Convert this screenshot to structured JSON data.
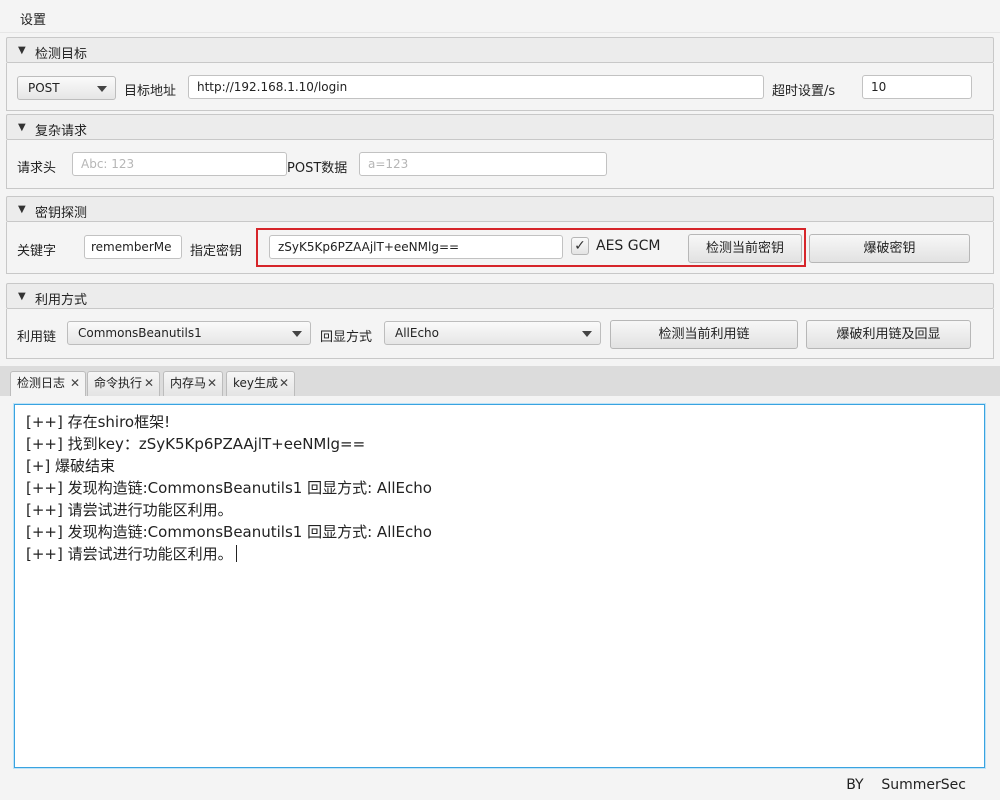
{
  "menubar": {
    "settings": "设置"
  },
  "target_section": {
    "title": "检测目标",
    "method": "POST",
    "url_label": "目标地址",
    "url_value": "http://192.168.1.10/login",
    "timeout_label": "超时设置/s",
    "timeout_value": "10"
  },
  "complex_section": {
    "title": "复杂请求",
    "header_label": "请求头",
    "header_placeholder": "Abc: 123",
    "post_label": "POST数据",
    "post_placeholder": "a=123"
  },
  "key_section": {
    "title": "密钥探测",
    "keyword_label": "关键字",
    "keyword_value": "rememberMe",
    "key_label": "指定密钥",
    "key_value": "zSyK5Kp6PZAAjlT+eeNMlg==",
    "aes_gcm_label": "AES GCM",
    "aes_gcm_checked": "✓",
    "detect_key_button": "检测当前密钥",
    "brute_key_button": "爆破密钥"
  },
  "exploit_section": {
    "title": "利用方式",
    "chain_label": "利用链",
    "chain_value": "CommonsBeanutils1",
    "echo_label": "回显方式",
    "echo_value": "AllEcho",
    "detect_chain_button": "检测当前利用链",
    "brute_chain_button": "爆破利用链及回显"
  },
  "tabs": [
    {
      "label": "检测日志"
    },
    {
      "label": "命令执行"
    },
    {
      "label": "内存马"
    },
    {
      "label": "key生成"
    }
  ],
  "log_lines": [
    "[++] 存在shiro框架!",
    "[++] 找到key：zSyK5Kp6PZAAjlT+eeNMlg==",
    "[+] 爆破结束",
    "[++] 发现构造链:CommonsBeanutils1  回显方式: AllEcho",
    "[++] 请尝试进行功能区利用。",
    "[++] 发现构造链:CommonsBeanutils1  回显方式: AllEcho",
    "[++] 请尝试进行功能区利用。"
  ],
  "footer": "BY    SummerSec",
  "colors": {
    "highlight": "#d6252a",
    "focus": "#39a3e0"
  }
}
